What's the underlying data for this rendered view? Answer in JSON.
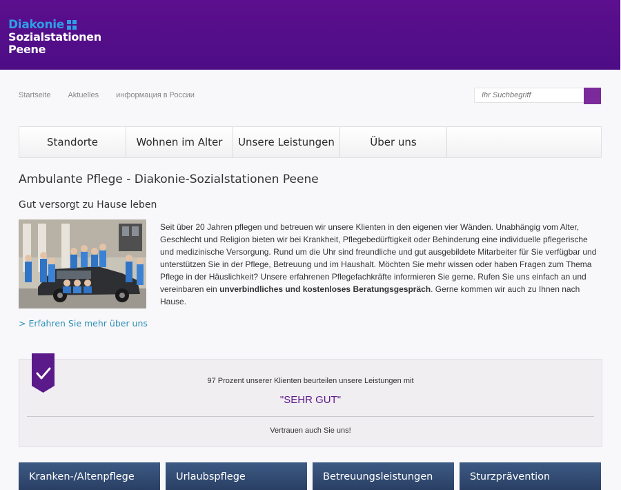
{
  "brand": {
    "name_line1": "Diakonie",
    "name_line2": "Sozialstationen",
    "name_line3": "Peene",
    "color_primary": "#4d0d85",
    "color_accent": "#2f9ee6"
  },
  "topnav": {
    "items": [
      "Startseite",
      "Aktuelles",
      "информация в России"
    ]
  },
  "search": {
    "placeholder": "Ihr Suchbegriff",
    "icon": "search-icon"
  },
  "mainnav": {
    "items": [
      "Standorte",
      "Wohnen im Alter",
      "Unsere Leistungen",
      "Über uns"
    ]
  },
  "content": {
    "page_title": "Ambulante Pflege - Diakonie-Sozialstationen Peene",
    "section_title": "Gut versorgt zu Hause leben",
    "photo_alt": "Team der Diakonie-Sozialstationen vor einem Auto",
    "intro_part1": "Seit über 20 Jahren pflegen und betreuen wir unsere Klienten in den eigenen vier Wänden. Unabhängig vom Alter, Geschlecht und Religion bieten wir bei Krankheit, Pflegebedürftigkeit oder Behinderung eine individuelle pflegerische und medizinische Versorgung. Rund um die Uhr sind freundliche und gut ausgebildete Mitarbeiter für Sie verfügbar und unterstützen Sie in der Pflege, Betreuung und im Haushalt. Möchten Sie mehr wissen oder haben Fragen zum Thema Pflege in der Häuslichkeit? Unsere erfahrenen Pflegefachkräfte informieren Sie gerne. Rufen Sie uns einfach an und vereinbaren ein ",
    "intro_bold": "unverbindliches und kostenloses Beratungsgespräch",
    "intro_part2": ". Gerne kommen wir auch zu Ihnen nach Hause.",
    "more_link": "> Erfahren Sie mehr über uns"
  },
  "rating": {
    "line1": "97 Prozent unserer Klienten beurteilen unsere Leistungen mit",
    "value": "\"SEHR GUT\"",
    "line2": "Vertrauen auch Sie uns!",
    "icon": "checkmark-ribbon-icon",
    "ribbon_color": "#5a1a8a"
  },
  "tiles": {
    "items": [
      "Kranken-/Altenpflege",
      "Urlaubspflege",
      "Betreuungsleistungen",
      "Sturzprävention"
    ],
    "color": "#34507a"
  }
}
